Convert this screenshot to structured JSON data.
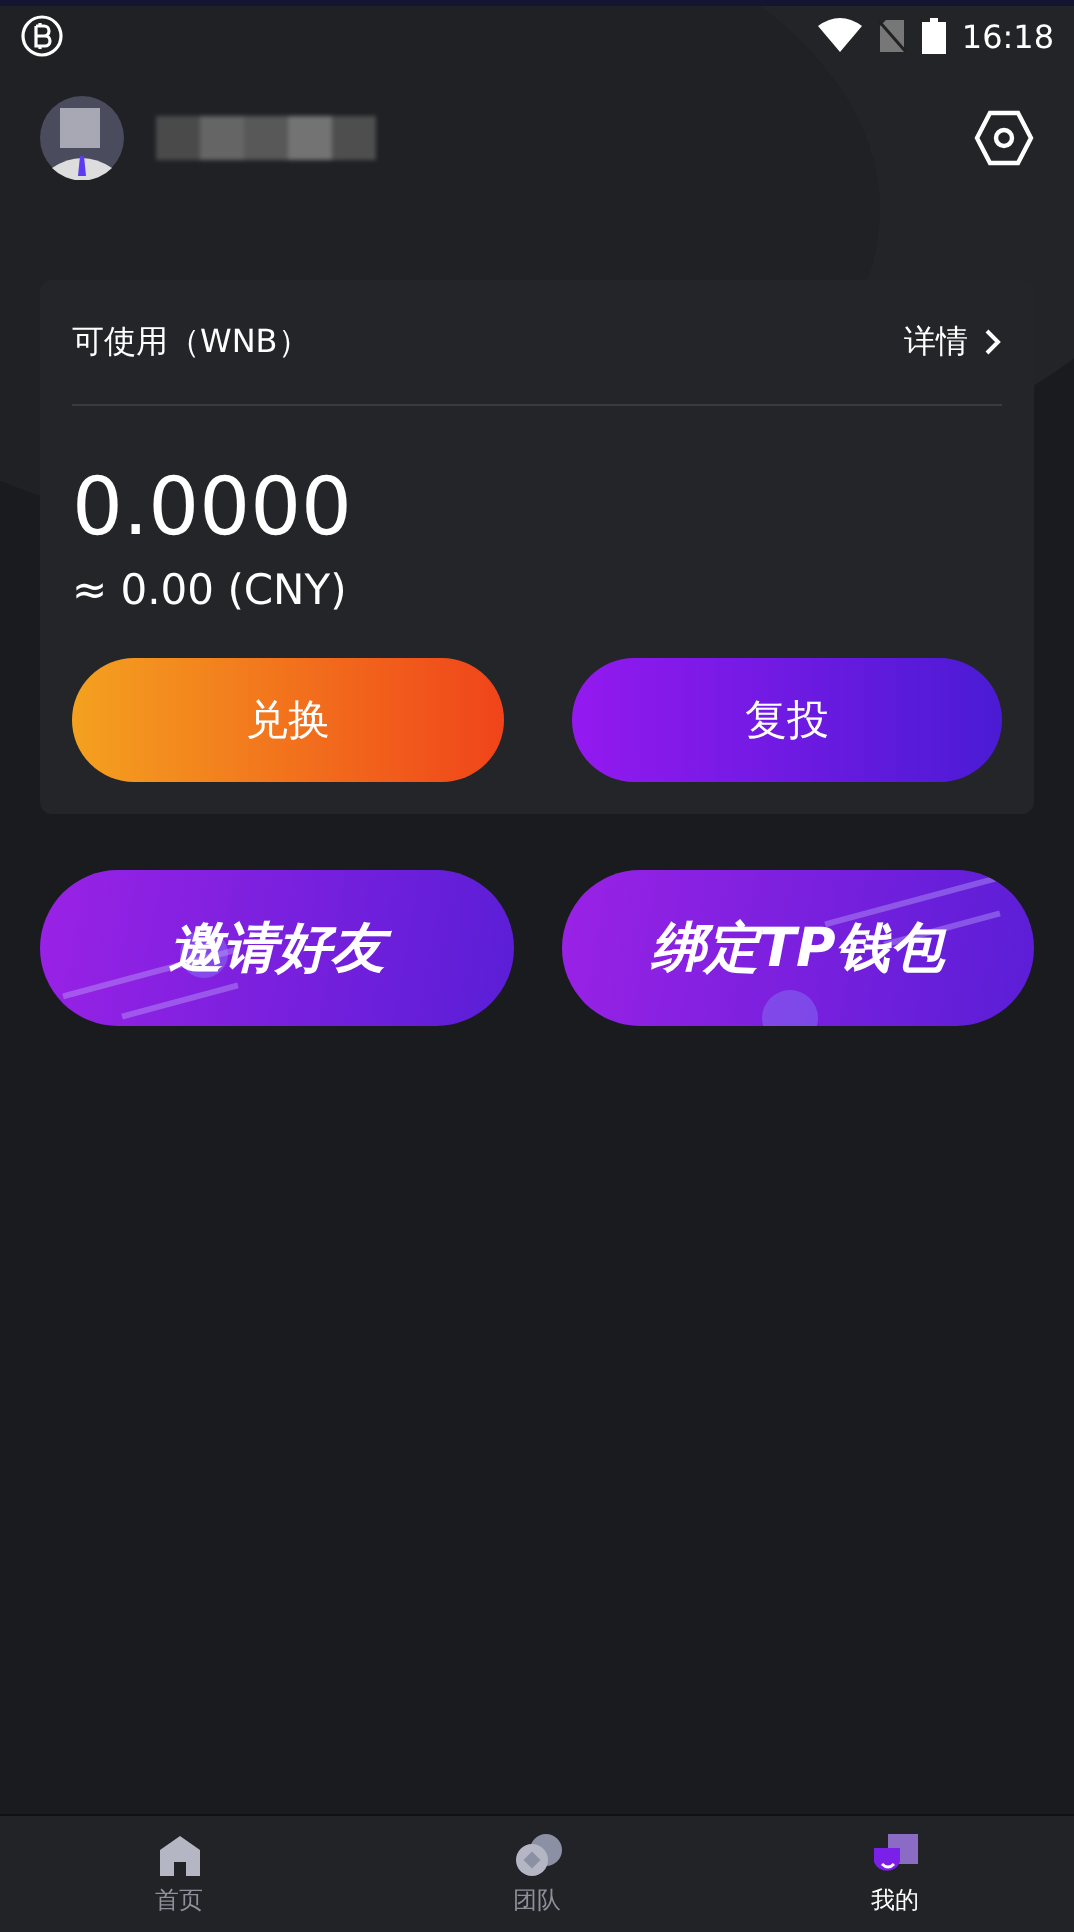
{
  "status_bar": {
    "time": "16:18"
  },
  "balance_card": {
    "title": "可使用（WNB）",
    "details_link": "详情",
    "amount": "0.0000",
    "approx": "≈ 0.00 (CNY)",
    "buttons": [
      {
        "label": "兑换",
        "kind": "orange"
      },
      {
        "label": "复投",
        "kind": "purple"
      }
    ]
  },
  "banners": [
    {
      "label": "邀请好友"
    },
    {
      "label": "绑定TP钱包"
    }
  ],
  "bottom_nav": [
    {
      "label": "首页",
      "kind": "home",
      "selected": false
    },
    {
      "label": "团队",
      "kind": "team",
      "selected": false
    },
    {
      "label": "我的",
      "kind": "me",
      "selected": true
    }
  ]
}
